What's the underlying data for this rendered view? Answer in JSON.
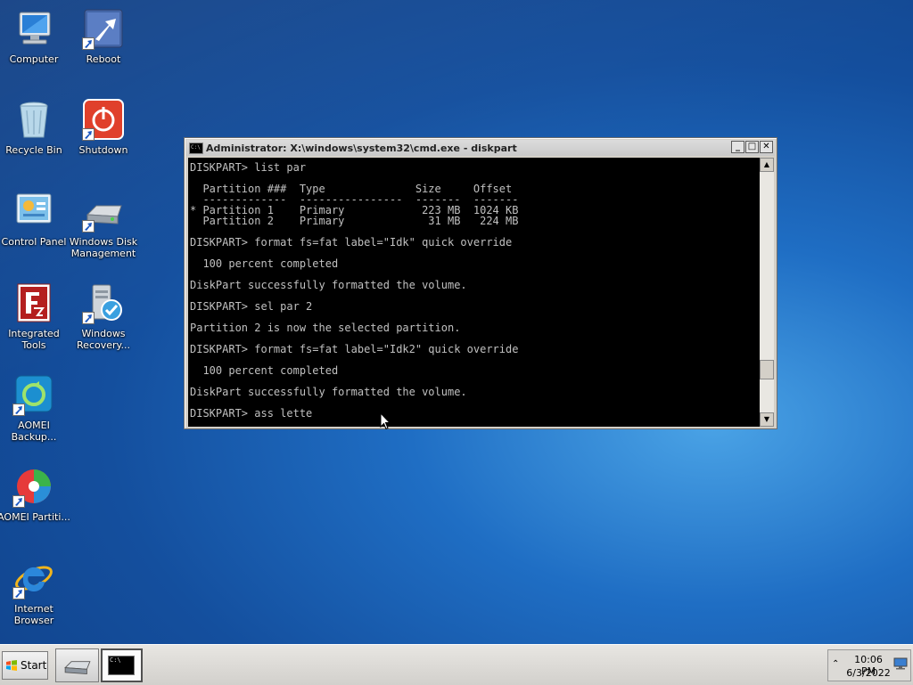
{
  "desktop": {
    "icons": [
      {
        "label": "Computer",
        "icon": "computer-icon"
      },
      {
        "label": "Reboot",
        "icon": "reboot-icon"
      },
      {
        "label": "Recycle Bin",
        "icon": "recycle-bin-icon"
      },
      {
        "label": "Shutdown",
        "icon": "shutdown-icon"
      },
      {
        "label": "Control Panel",
        "icon": "control-panel-icon"
      },
      {
        "label": "Windows Disk Management",
        "icon": "disk-management-icon"
      },
      {
        "label": "Integrated Tools",
        "icon": "integrated-tools-icon"
      },
      {
        "label": "Windows Recovery...",
        "icon": "windows-recovery-icon"
      },
      {
        "label": "AOMEI Backup...",
        "icon": "aomei-backup-icon"
      },
      {
        "label": "AOMEI Partiti...",
        "icon": "aomei-partition-icon"
      },
      {
        "label": "Internet Browser",
        "icon": "internet-browser-icon"
      }
    ]
  },
  "cmd_window": {
    "title": "Administrator: X:\\windows\\system32\\cmd.exe - diskpart",
    "icon_text": "C:\\",
    "buttons": {
      "minimize": "_",
      "maximize": "□",
      "close": "✕"
    },
    "console_lines": [
      "DISKPART> list par",
      "",
      "  Partition ###  Type              Size     Offset",
      "  -------------  ----------------  -------  -------",
      "* Partition 1    Primary            223 MB  1024 KB",
      "  Partition 2    Primary             31 MB   224 MB",
      "",
      "DISKPART> format fs=fat label=\"Idk\" quick override",
      "",
      "  100 percent completed",
      "",
      "DiskPart successfully formatted the volume.",
      "",
      "DISKPART> sel par 2",
      "",
      "Partition 2 is now the selected partition.",
      "",
      "DISKPART> format fs=fat label=\"Idk2\" quick override",
      "",
      "  100 percent completed",
      "",
      "DiskPart successfully formatted the volume.",
      "",
      "DISKPART> ass lette"
    ],
    "scrollbar": {
      "up": "▲",
      "down": "▼",
      "position_fraction": 0.85
    }
  },
  "taskbar": {
    "start_label": "Start",
    "buttons": [
      {
        "name": "drive-tool",
        "icon": "hard-drive-icon"
      },
      {
        "name": "cmd",
        "icon": "console-icon",
        "label": "C:\\"
      }
    ],
    "tray": {
      "expand": "⌃",
      "time": "10:06 PM",
      "date": "6/3/2022",
      "icon": "network-icon"
    }
  },
  "colors": {
    "desktop": "#1f6ec4",
    "console_bg": "#000000",
    "console_text": "#c0c0c0",
    "taskbar": "#d8d6d2"
  }
}
